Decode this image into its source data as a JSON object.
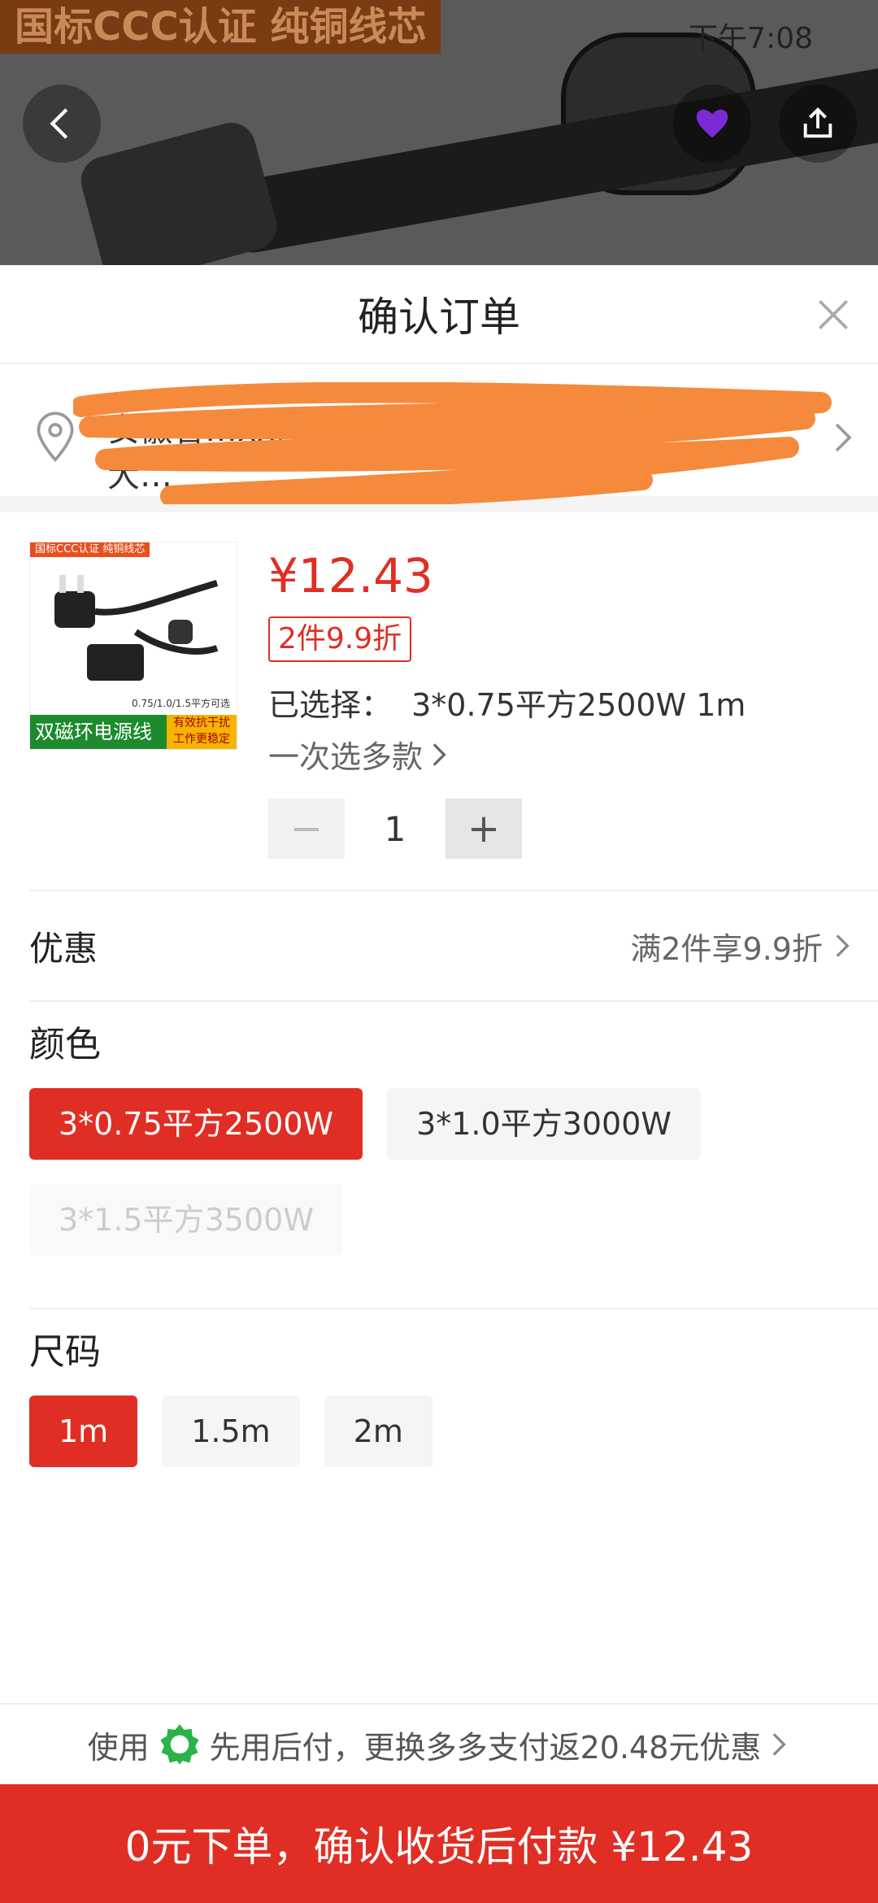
{
  "banner": {
    "text": "国标CCC认证 纯铜线芯"
  },
  "status_bar": {
    "time": "下午7:08"
  },
  "header": {
    "title": "确认订单"
  },
  "address": {
    "line1": "安徽省…xx区 xx路 …号楼…室…",
    "line2": "大…"
  },
  "product": {
    "image": {
      "top_label": "国标CCC认证 纯铜线芯",
      "bottom_label": "双磁环电源线",
      "badge": "有效抗干扰 工作更稳定",
      "spec": "0.75/1.0/1.5平方可选"
    },
    "price": "¥12.43",
    "discount_tag": "2件9.9折",
    "selected_label": "已选择：",
    "selected_value": "3*0.75平方2500W 1m",
    "multi_select": "一次选多款",
    "quantity": "1",
    "minus": "−",
    "plus": "+"
  },
  "coupon": {
    "label": "优惠",
    "value": "满2件享9.9折"
  },
  "color": {
    "title": "颜色",
    "options": [
      "3*0.75平方2500W",
      "3*1.0平方3000W",
      "3*1.5平方3500W"
    ]
  },
  "size": {
    "title": "尺码",
    "options": [
      "1m",
      "1.5m",
      "2m"
    ]
  },
  "pay_tip": {
    "prefix": "使用",
    "text": "先用后付，更换多多支付返20.48元优惠"
  },
  "submit": {
    "label": "0元下单，确认收货后付款 ¥12.43"
  },
  "colors": {
    "accent": "#e02e24",
    "scribble": "#f58a3d",
    "pay_badge": "#2bb34a"
  }
}
